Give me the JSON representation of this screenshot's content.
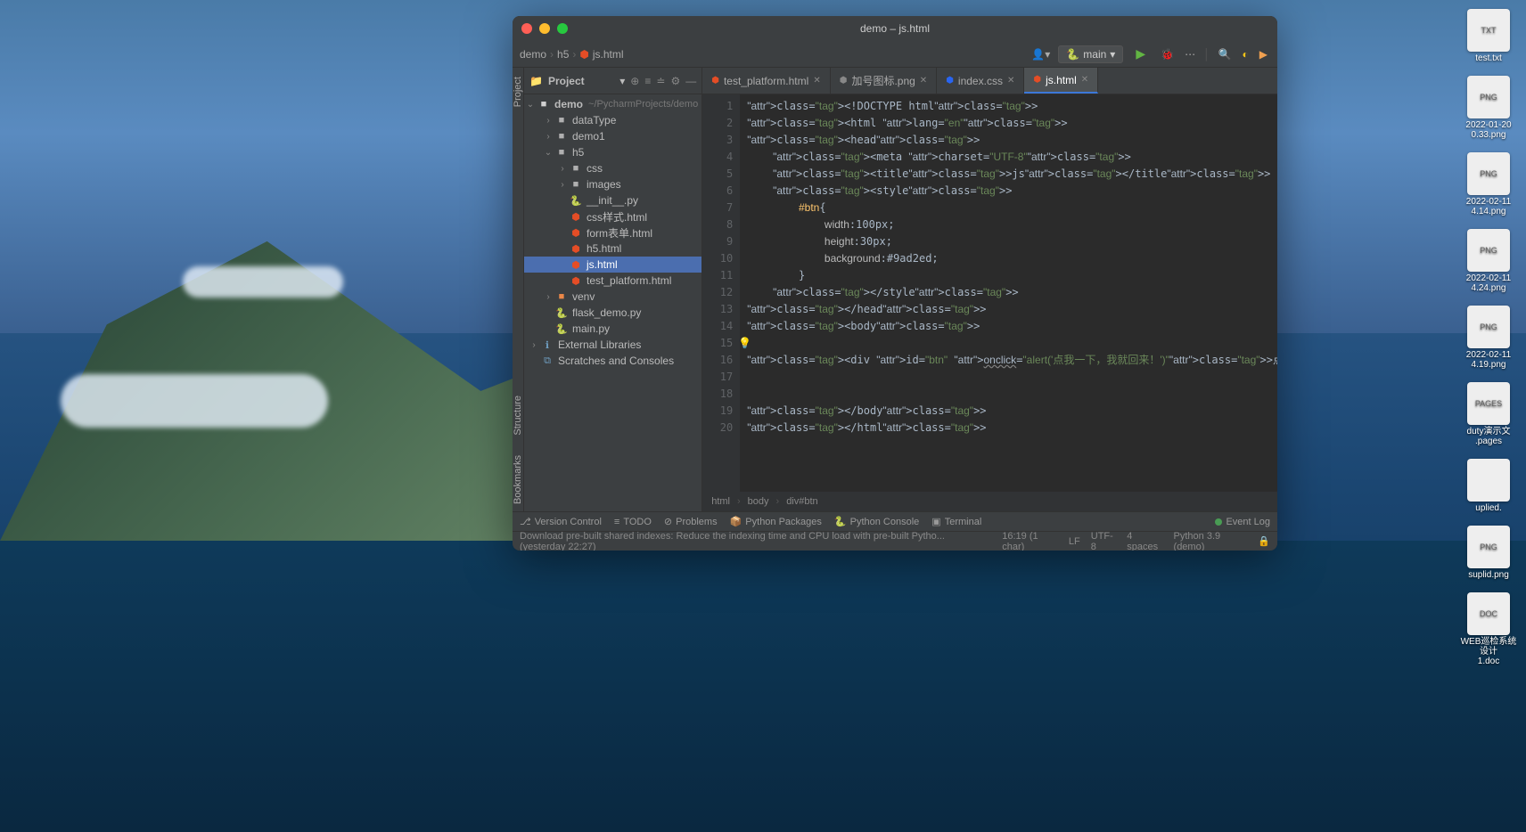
{
  "window": {
    "title": "demo – js.html"
  },
  "navbar": {
    "breadcrumbs": [
      "demo",
      "h5",
      "js.html"
    ],
    "run_config": "main",
    "python_prefix": "🐍"
  },
  "project_panel": {
    "title": "Project"
  },
  "tree": {
    "root": {
      "name": "demo",
      "path": "~/PycharmProjects/demo"
    },
    "items": [
      {
        "name": "dataType",
        "type": "folder",
        "indent": 1,
        "arrow": "›"
      },
      {
        "name": "demo1",
        "type": "folder",
        "indent": 1,
        "arrow": "›"
      },
      {
        "name": "h5",
        "type": "folder",
        "indent": 1,
        "arrow": "⌄",
        "open": true
      },
      {
        "name": "css",
        "type": "folder",
        "indent": 2,
        "arrow": "›"
      },
      {
        "name": "images",
        "type": "folder",
        "indent": 2,
        "arrow": "›"
      },
      {
        "name": "__init__.py",
        "type": "py",
        "indent": 2
      },
      {
        "name": "css样式.html",
        "type": "html",
        "indent": 2
      },
      {
        "name": "form表单.html",
        "type": "html",
        "indent": 2
      },
      {
        "name": "h5.html",
        "type": "html",
        "indent": 2
      },
      {
        "name": "js.html",
        "type": "html",
        "indent": 2,
        "selected": true
      },
      {
        "name": "test_platform.html",
        "type": "html",
        "indent": 2
      },
      {
        "name": "venv",
        "type": "folder-orange",
        "indent": 1,
        "arrow": "›"
      },
      {
        "name": "flask_demo.py",
        "type": "py",
        "indent": 1
      },
      {
        "name": "main.py",
        "type": "py",
        "indent": 1
      }
    ],
    "ext_lib": "External Libraries",
    "scratches": "Scratches and Consoles"
  },
  "tabs": [
    {
      "label": "test_platform.html",
      "icon": "html"
    },
    {
      "label": "加号图标.png",
      "icon": "img"
    },
    {
      "label": "index.css",
      "icon": "css"
    },
    {
      "label": "js.html",
      "icon": "html",
      "active": true
    }
  ],
  "code": {
    "lines": [
      {
        "n": 1,
        "t": "<!DOCTYPE html>",
        "raw": [
          "<",
          "!DOCTYPE ",
          "html",
          ">"
        ]
      },
      {
        "n": 2,
        "t": "<html lang=\"en\">"
      },
      {
        "n": 3,
        "t": "<head>"
      },
      {
        "n": 4,
        "t": "    <meta charset=\"UTF-8\">"
      },
      {
        "n": 5,
        "t": "    <title>js</title>"
      },
      {
        "n": 6,
        "t": "    <style>"
      },
      {
        "n": 7,
        "t": "        #btn{"
      },
      {
        "n": 8,
        "t": "            width:100px;"
      },
      {
        "n": 9,
        "t": "            height:30px;"
      },
      {
        "n": 10,
        "t": "            background:#9ad2ed;"
      },
      {
        "n": 11,
        "t": "        }"
      },
      {
        "n": 12,
        "t": "    </style>"
      },
      {
        "n": 13,
        "t": "</head>"
      },
      {
        "n": 14,
        "t": "<body>"
      },
      {
        "n": 15,
        "t": ""
      },
      {
        "n": 16,
        "t": "<div id=\"btn\" onclick=\"alert('点我一下，我就回来！')\">点击我试试</div>"
      },
      {
        "n": 17,
        "t": ""
      },
      {
        "n": 18,
        "t": ""
      },
      {
        "n": 19,
        "t": "</body>"
      },
      {
        "n": 20,
        "t": "</html>"
      }
    ]
  },
  "breadcrumb_bottom": [
    "html",
    "body",
    "div#btn"
  ],
  "sidebar_tools": [
    "Project",
    "Structure",
    "Bookmarks"
  ],
  "bottom_tools": {
    "vc": "Version Control",
    "todo": "TODO",
    "problems": "Problems",
    "pkg": "Python Packages",
    "console": "Python Console",
    "terminal": "Terminal",
    "eventlog": "Event Log"
  },
  "statusbar": {
    "msg": "Download pre-built shared indexes: Reduce the indexing time and CPU load with pre-built Pytho... (yesterday 22:27)",
    "pos": "16:19 (1 char)",
    "sep": "LF",
    "enc": "UTF-8",
    "indent": "4 spaces",
    "interp": "Python 3.9 (demo)"
  },
  "desktop_files": [
    "test.txt",
    "2022-01-20\n0.33.png",
    "2022-02-11\n4.14.png",
    "2022-02-11\n4.24.png",
    "2022-02-11\n4.19.png",
    "duty演示文\n.pages",
    "uplied.",
    "suplid.png",
    "WEB巡检系统设计\n1.doc"
  ]
}
